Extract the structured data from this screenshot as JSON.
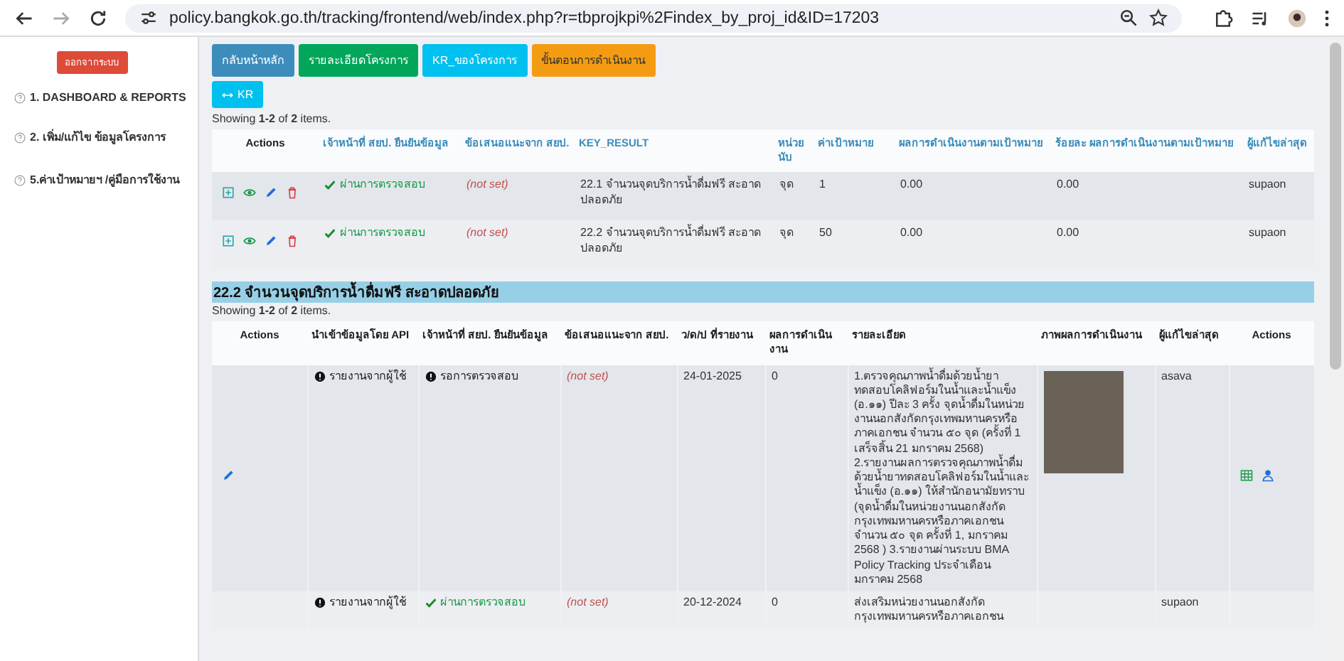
{
  "browser": {
    "url": "policy.bangkok.go.th/tracking/frontend/web/index.php?r=tbprojkpi%2Findex_by_proj_id&ID=17203"
  },
  "sidebar": {
    "logout_button": "ออกจากระบบ",
    "items": [
      "1. DASHBOARD & REPORTS",
      "2. เพิ่ม/แก้ไข ข้อมูลโครงการ",
      "5.ค่าเป้าหมายฯ /คู่มือการใช้งาน"
    ]
  },
  "toolbar": {
    "buttons": [
      {
        "label": "กลับหน้าหลัก",
        "kind": "primary"
      },
      {
        "label": "รายละเอียดโครงการ",
        "kind": "success"
      },
      {
        "label": "KR_ของโครงการ",
        "kind": "info"
      },
      {
        "label": "ขั้นตอนการดำเนินงาน",
        "kind": "warning"
      }
    ],
    "kr_button": "KR"
  },
  "kr_table": {
    "summary": "Showing **1-2** of **2** items.",
    "columns": [
      {
        "label": "Actions",
        "sortable": false
      },
      {
        "label": "เจ้าหน้าที่ สยป. ยืนยันข้อมูล",
        "sortable": true
      },
      {
        "label": "ข้อเสนอแนะจาก สยป.",
        "sortable": true
      },
      {
        "label": "KEY_RESULT",
        "sortable": true
      },
      {
        "label": "หน่วยนับ",
        "sortable": true
      },
      {
        "label": "ค่าเป้าหมาย",
        "sortable": true
      },
      {
        "label": "ผลการดำเนินงานตามเป้าหมาย",
        "sortable": true
      },
      {
        "label": "ร้อยละ ผลการดำเนินงานตามเป้าหมาย",
        "sortable": true
      },
      {
        "label": "ผู้แก้ไขล่าสุด",
        "sortable": true
      }
    ],
    "rows": [
      {
        "actions": [
          {
            "kind": "add"
          },
          {
            "kind": "view"
          },
          {
            "kind": "edit"
          },
          {
            "kind": "delete"
          }
        ],
        "status": {
          "kind": "passed",
          "text": "ผ่านการตรวจสอบ"
        },
        "suggestion": "(not set)",
        "key_result": "22.1 จำนวนจุดบริการน้ำดื่มฟรี สะอาดปลอดภัย",
        "unit": "จุด",
        "target": "1",
        "result": "0.00",
        "percent": "0.00",
        "editor": "supaon"
      },
      {
        "actions": [
          {
            "kind": "add"
          },
          {
            "kind": "view"
          },
          {
            "kind": "edit"
          },
          {
            "kind": "delete"
          }
        ],
        "status": {
          "kind": "passed",
          "text": "ผ่านการตรวจสอบ"
        },
        "suggestion": "(not set)",
        "key_result": "22.2 จำนวนจุดบริการน้ำดื่มฟรี สะอาดปลอดภัย",
        "unit": "จุด",
        "target": "50",
        "result": "0.00",
        "percent": "0.00",
        "editor": "supaon"
      }
    ]
  },
  "report_section": {
    "title": "22.2 จำนวนจุดบริการน้ำดื่มฟรี สะอาดปลอดภัย",
    "summary": "Showing **1-2** of **2** items.",
    "columns": [
      "Actions",
      "นำเข้าข้อมูลโดย API",
      "เจ้าหน้าที่ สยป. ยืนยันข้อมูล",
      "ข้อเสนอแนะจาก สยป.",
      "ว/ด/ป ที่รายงาน",
      "ผลการดำเนินงาน",
      "รายละเอียด",
      "ภาพผลการดำเนินงาน",
      "ผู้แก้ไขล่าสุด",
      "Actions"
    ],
    "rows": [
      {
        "actions": [
          {
            "kind": "edit"
          }
        ],
        "api_source": {
          "kind": "pending",
          "text": "รายงานจากผู้ใช้"
        },
        "verify": {
          "kind": "pending",
          "text": "รอการตรวจสอบ"
        },
        "suggestion": "(not set)",
        "date": "24-01-2025",
        "result": "0",
        "detail": "1.ตรวจคุณภาพน้ำดื่มด้วยน้ำยาทดสอบโคลิฟอร์มในน้ำและน้ำแข็ง (อ.๑๑) ปีละ 3 ครั้ง จุดน้ำดื่มในหน่วยงานนอกสังกัดกรุงเทพมหานครหรือภาคเอกชน จำนวน ๕๐ จุด (ครั้งที่ 1 เสร็จสิ้น 21 มกราคม 2568) 2.รายงานผลการตรวจคุณภาพน้ำดื่มด้วยน้ำยาทดสอบโคลิฟอร์มในน้ำและน้ำแข็ง (อ.๑๑) ให้สำนักอนามัยทราบ (จุดน้ำดื่มในหน่วยงานนอกสังกัดกรุงเทพมหานครหรือภาคเอกชน จำนวน ๕๐ จุด ครั้งที่ 1, มกราคม 2568 ) 3.รายงานผ่านระบบ BMA Policy Tracking ประจำเดือนมกราคม 2568",
        "photo": true,
        "editor": "asava",
        "side_actions": [
          {
            "kind": "table"
          },
          {
            "kind": "person"
          }
        ]
      },
      {
        "api_source": {
          "kind": "pending",
          "text": "รายงานจากผู้ใช้"
        },
        "verify": {
          "kind": "passed",
          "text": "ผ่านการตรวจสอบ"
        },
        "suggestion": "(not set)",
        "date": "20-12-2024",
        "result": "0",
        "detail": "ส่งเสริมหน่วยงานนอกสังกัดกรุงเทพมหานครหรือภาคเอกชน",
        "photo": false,
        "editor": "supaon"
      }
    ]
  }
}
